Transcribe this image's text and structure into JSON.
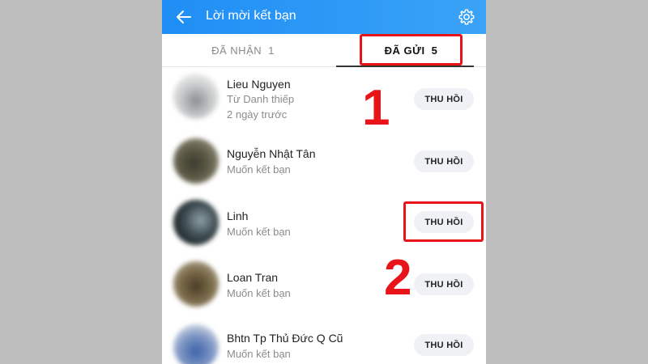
{
  "header": {
    "title": "Lời mời kết bạn",
    "back_icon": "arrow-left-icon",
    "settings_icon": "gear-icon"
  },
  "tabs": [
    {
      "label": "ĐÃ NHẬN",
      "count": "1",
      "active": false
    },
    {
      "label": "ĐÃ GỬI",
      "count": "5",
      "active": true
    }
  ],
  "requests": [
    {
      "name": "Lieu Nguyen",
      "source": "Từ Danh thiếp",
      "time": "2 ngày trước",
      "button": "THU HỒI"
    },
    {
      "name": "Nguyễn Nhật Tân",
      "source": "Muốn kết bạn",
      "button": "THU HỒI"
    },
    {
      "name": "Linh",
      "source": "Muốn kết bạn",
      "button": "THU HỒI"
    },
    {
      "name": "Loan Tran",
      "source": "Muốn kết bạn",
      "button": "THU HỒI"
    },
    {
      "name": "Bhtn Tp Thủ Đức Q Cũ",
      "source": "Muốn kết bạn",
      "button": "THU HỒI"
    }
  ],
  "annotations": {
    "step1": "1",
    "step2": "2"
  },
  "colors": {
    "header_blue": "#1f8ef5",
    "highlight_red": "#e8141a",
    "button_bg": "#eff1f4"
  }
}
